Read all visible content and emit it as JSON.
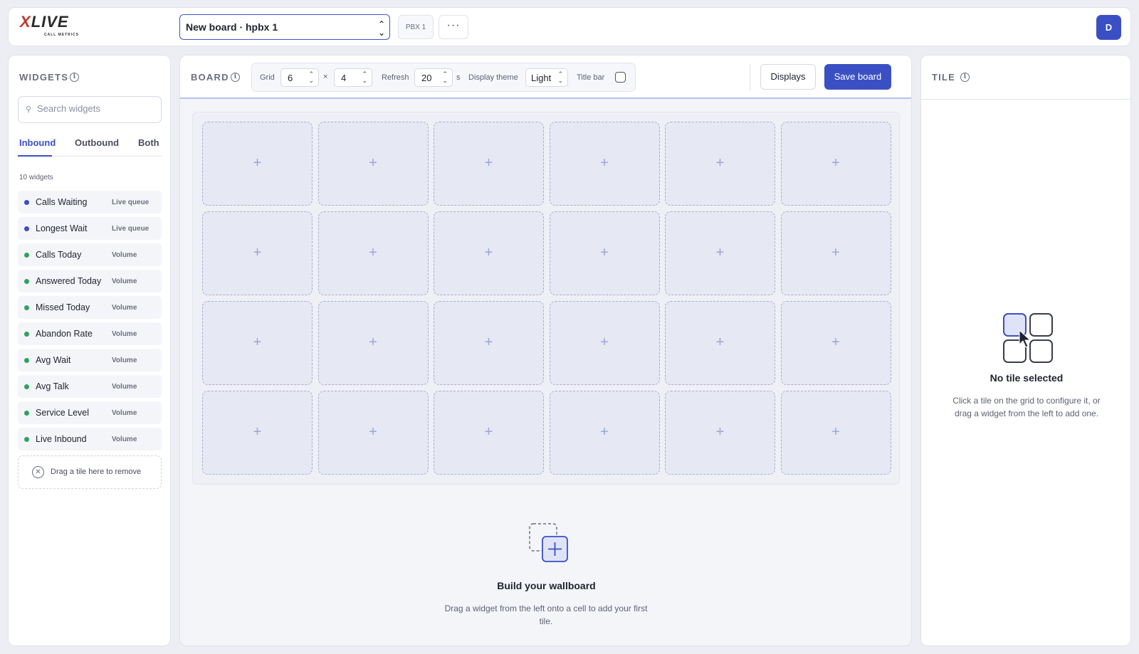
{
  "header": {
    "logo_word_first": "X",
    "logo_word_rest": "LIVE",
    "logo_subtitle": "CALL METRICS",
    "board_select_value": "New board · hpbx 1",
    "pbx_badge": "PBX 1",
    "more_label": "···",
    "avatar_initial": "D"
  },
  "widgets_panel": {
    "title": "WIDGETS",
    "search_placeholder": "Search widgets",
    "tabs": [
      {
        "label": "Inbound",
        "active": true
      },
      {
        "label": "Outbound",
        "active": false
      },
      {
        "label": "Both",
        "active": false
      }
    ],
    "count_label": "10 widgets",
    "items": [
      {
        "name": "Calls Waiting",
        "category": "Live queue",
        "dot_color": "#3b4fc4"
      },
      {
        "name": "Longest Wait",
        "category": "Live queue",
        "dot_color": "#3b4fc4"
      },
      {
        "name": "Calls Today",
        "category": "Volume",
        "dot_color": "#2fa35a"
      },
      {
        "name": "Answered Today",
        "category": "Volume",
        "dot_color": "#2fa35a"
      },
      {
        "name": "Missed Today",
        "category": "Volume",
        "dot_color": "#2fa35a"
      },
      {
        "name": "Abandon Rate",
        "category": "Volume",
        "dot_color": "#2fa35a"
      },
      {
        "name": "Avg Wait",
        "category": "Volume",
        "dot_color": "#2fa35a"
      },
      {
        "name": "Avg Talk",
        "category": "Volume",
        "dot_color": "#2fa35a"
      },
      {
        "name": "Service Level",
        "category": "Volume",
        "dot_color": "#2fa35a"
      },
      {
        "name": "Live Inbound",
        "category": "Volume",
        "dot_color": "#2fa35a"
      }
    ],
    "remove_drop_label": "Drag a tile here to remove"
  },
  "board_panel": {
    "title": "BOARD",
    "grid_label": "Grid",
    "grid_cols": "6",
    "grid_times": "×",
    "grid_rows": "4",
    "refresh_label": "Refresh",
    "refresh_value": "20",
    "refresh_unit": "s",
    "theme_label": "Display theme",
    "theme_value": "Light",
    "title_bar_label": "Title bar",
    "title_bar_checked": false,
    "displays_button": "Displays",
    "save_button": "Save board",
    "cell_plus": "+",
    "empty_title": "Build your wallboard",
    "empty_desc": "Drag a widget from the left onto a cell to add your first tile."
  },
  "tile_panel": {
    "title": "TILE",
    "empty_title": "No tile selected",
    "empty_desc": "Click a tile on the grid to configure it, or drag a widget from the left to add one."
  },
  "colors": {
    "accent": "#3b4fc4",
    "live_queue_dot": "#3b4fc4",
    "volume_dot": "#2fa35a",
    "brand_red": "#c0392b"
  }
}
